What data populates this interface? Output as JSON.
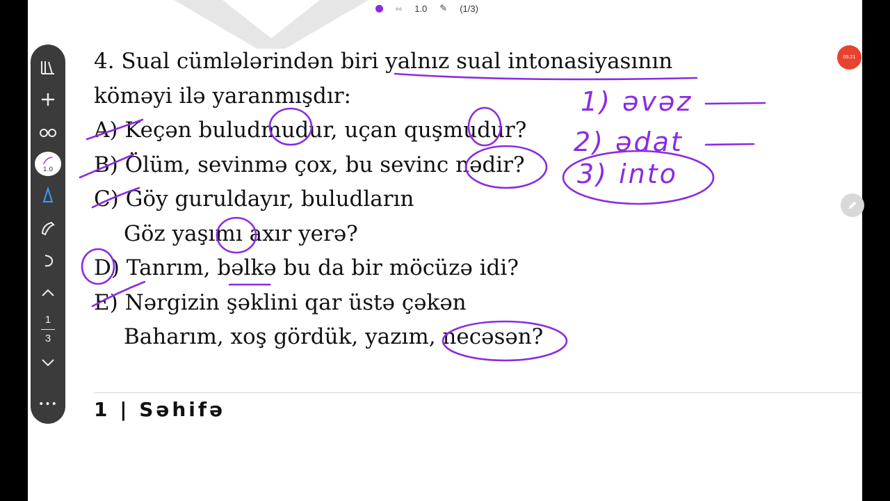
{
  "top_bar": {
    "zoom": "1.0",
    "page_indicator": "(1/3)",
    "icons": [
      "color-dot-icon",
      "glasses-icon",
      "pen-icon"
    ],
    "accent_color": "#8a2be2"
  },
  "question": {
    "lines": [
      "4. Sual cümlələrindən biri yalnız sual intonasiyasının",
      "köməyi ilə yaranmışdır:",
      "A) Keçən buludmudur, uçan quşmudur?",
      "B) Ölüm, sevinmə çox, bu sevinc nədir?",
      "C) Göy guruldayır, buludların",
      "Göz yaşımı axır yerə?",
      "D) Tanrım, bəlkə bu da bir möcüzə idi?",
      "E) Nərgizin şəklini qar üstə çəkən",
      "Baharım, xoş gördük, yazım, necəsən?"
    ]
  },
  "handwriting": {
    "note1": "1) əvəz",
    "note2": "2) ədat",
    "note3": "3) into"
  },
  "footer": {
    "label": "1 | Səhifə"
  },
  "toolbar": {
    "pen_size": "1.0",
    "current_page": "1",
    "total_pages": "3",
    "more": "•••"
  },
  "recording": {
    "timer": "05:21"
  }
}
